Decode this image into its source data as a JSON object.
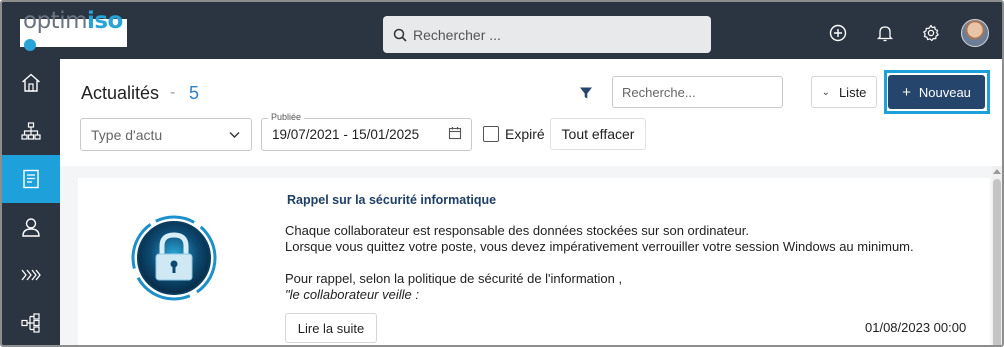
{
  "app": {
    "logo_part1": "optim",
    "logo_part2": "iso",
    "brand_color": "#27a3d8",
    "topbar_color": "#2b3541"
  },
  "topbar": {
    "search_placeholder": "Rechercher ...",
    "icons": [
      "plus-circle-icon",
      "bell-icon",
      "gear-icon",
      "avatar"
    ]
  },
  "sidebar": {
    "items": [
      {
        "icon": "home-icon",
        "active": false
      },
      {
        "icon": "org-chart-icon",
        "active": false
      },
      {
        "icon": "news-icon",
        "active": true
      },
      {
        "icon": "user-icon",
        "active": false
      },
      {
        "icon": "process-chevrons-icon",
        "active": false
      },
      {
        "icon": "hierarchy-icon",
        "active": false
      }
    ],
    "active_color": "#1ea1db"
  },
  "header": {
    "title": "Actualités",
    "separator": "-",
    "count": "5",
    "search_placeholder": "Recherche...",
    "view_label": "Liste",
    "new_label": "Nouveau",
    "new_color": "#26456c"
  },
  "filters": {
    "type_placeholder": "Type d'actu",
    "date_legend": "Publiée",
    "date_range": "19/07/2021 - 15/01/2025",
    "expired_label": "Expiré",
    "expired_checked": false,
    "clear_label": "Tout effacer"
  },
  "news": [
    {
      "title": "Rappel sur la sécurité informatique",
      "lines": [
        "Chaque collaborateur est responsable des données stockées sur son ordinateur.",
        "Lorsque vous quittez votre poste, vous devez impérativement verrouiller votre session Windows au minimum.",
        "",
        "Pour rappel, selon la politique de sécurité de l'information ,",
        "\"le collaborateur veille :"
      ],
      "read_more": "Lire la suite",
      "date": "01/08/2023 00:00",
      "image_icon": "padlock-icon"
    }
  ]
}
